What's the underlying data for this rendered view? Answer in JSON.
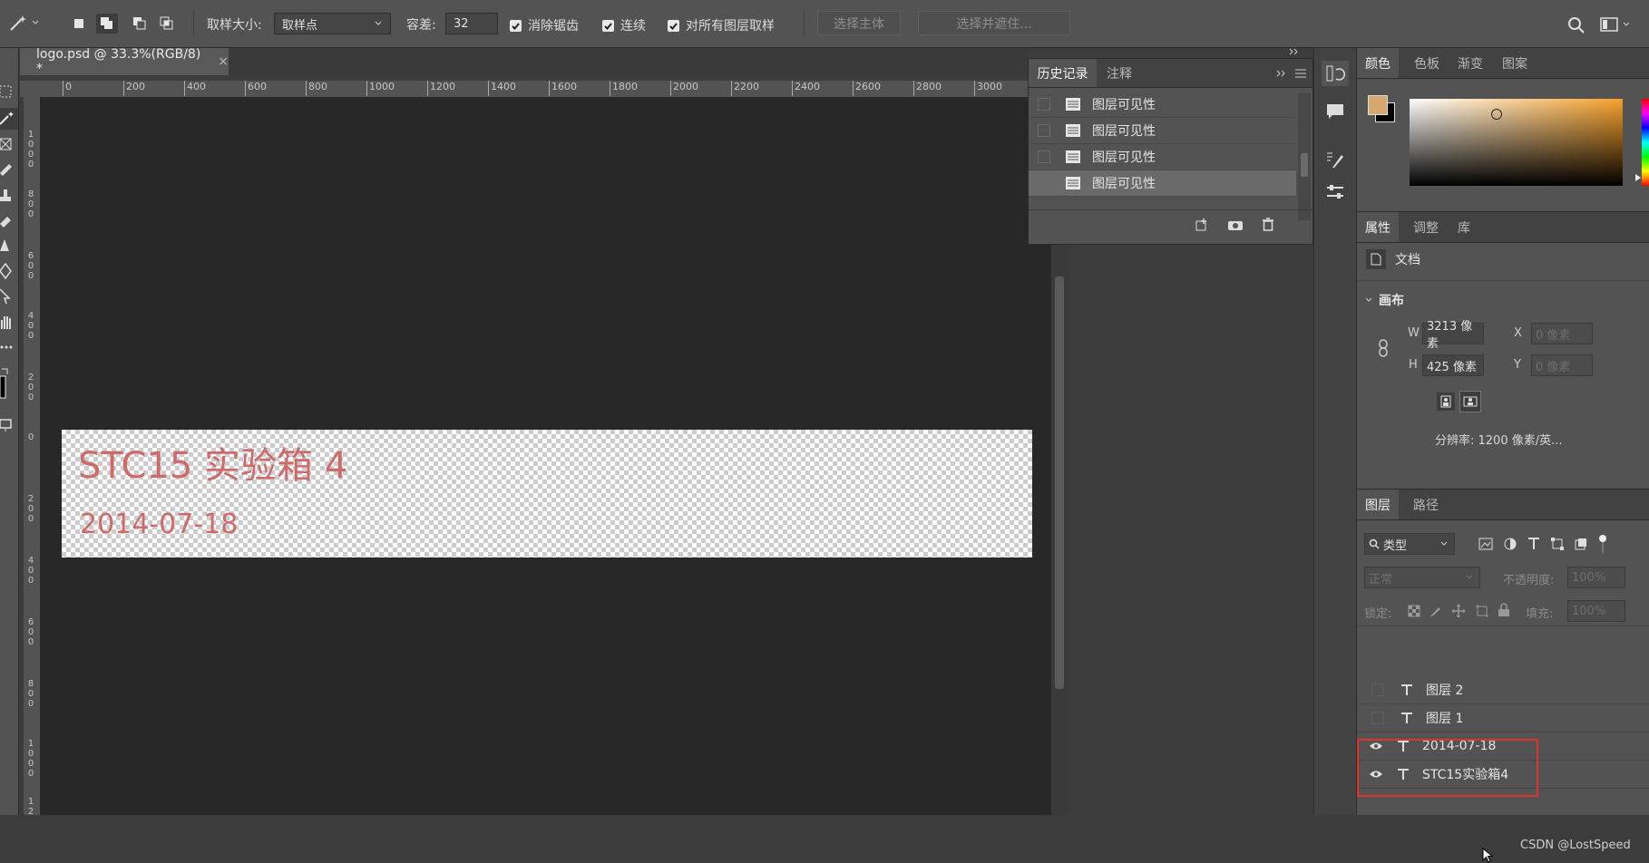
{
  "options_bar": {
    "sample_size_label": "取样大小:",
    "sample_size_value": "取样点",
    "tolerance_label": "容差:",
    "tolerance_value": "32",
    "anti_alias_label": "消除锯齿",
    "contiguous_label": "连续",
    "sample_all_layers_label": "对所有图层取样",
    "select_subject_label": "选择主体",
    "select_and_mask_label": "选择并遮住..."
  },
  "document": {
    "tab_title": "logo.psd @ 33.3%(RGB/8) *",
    "ruler_h": [
      "0",
      "200",
      "400",
      "600",
      "800",
      "1000",
      "1200",
      "1400",
      "1600",
      "1800",
      "2000",
      "2200",
      "2400",
      "2600",
      "2800",
      "3000"
    ],
    "ruler_v": [
      "1000",
      "800",
      "600",
      "400",
      "200",
      "0",
      "200",
      "400",
      "600",
      "800",
      "1000",
      "12"
    ],
    "canvas_text_1": "STC15 实验箱 4",
    "canvas_text_2": "2014-07-18",
    "text_color": "#d06a6a"
  },
  "history_panel": {
    "tabs": [
      "历史记录",
      "注释"
    ],
    "items": [
      "图层可见性",
      "图层可见性",
      "图层可见性",
      "图层可见性"
    ]
  },
  "color_panel": {
    "tabs": [
      "颜色",
      "色板",
      "渐变",
      "图案"
    ],
    "foreground": "#d4a86e",
    "background": "#000000",
    "hue_color": "#f7a12b"
  },
  "properties_panel": {
    "tabs": [
      "属性",
      "调整",
      "库"
    ],
    "doc_label": "文档",
    "canvas_section": "画布",
    "w_label": "W",
    "w_value": "3213 像素",
    "h_label": "H",
    "h_value": "425 像素",
    "x_label": "X",
    "x_placeholder": "0 像素",
    "y_label": "Y",
    "y_placeholder": "0 像素",
    "resolution": "分辨率: 1200 像素/英..."
  },
  "layers_panel": {
    "tabs": [
      "图层",
      "路径"
    ],
    "filter_label": "类型",
    "blend_mode": "正常",
    "opacity_label": "不透明度:",
    "opacity_value": "100%",
    "lock_label": "锁定:",
    "fill_label": "填充:",
    "fill_value": "100%",
    "layers": [
      {
        "name": "图层 2",
        "visible": false
      },
      {
        "name": "图层 1",
        "visible": false
      },
      {
        "name": "2014-07-18",
        "visible": true
      },
      {
        "name": "STC15实验箱4",
        "visible": true
      }
    ],
    "highlight_color": "#e03030"
  },
  "watermark": "CSDN @LostSpeed"
}
